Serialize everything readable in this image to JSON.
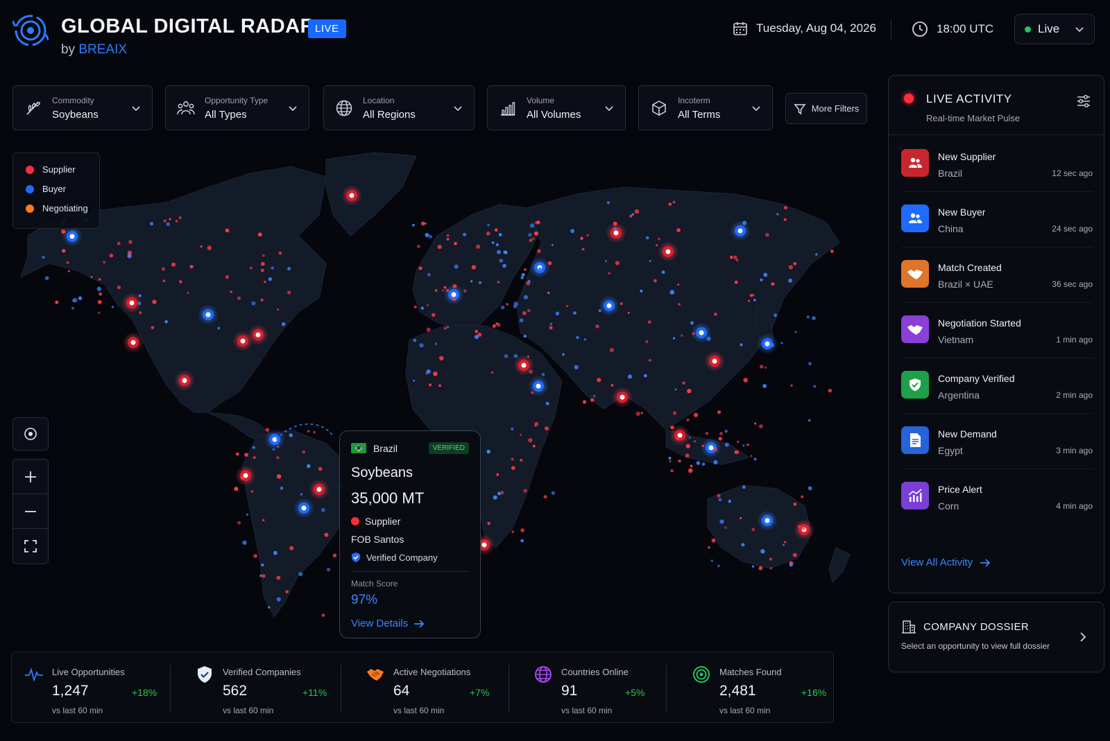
{
  "header": {
    "title": "GLOBAL DIGITAL RADAR",
    "live_badge": "LIVE",
    "by": "by",
    "brand": "BREAIX",
    "date": "Tuesday, Aug 04, 2026",
    "time": "18:00 UTC",
    "mode_select": "Live"
  },
  "filters": [
    {
      "label": "Commodity",
      "value": "Soybeans",
      "icon": "sprout-icon"
    },
    {
      "label": "Opportunity  Type",
      "value": "All Types",
      "icon": "people-icon"
    },
    {
      "label": "Location",
      "value": "All Regions",
      "icon": "globe-icon"
    },
    {
      "label": "Volume",
      "value": "All Volumes",
      "icon": "bar-chart-icon"
    },
    {
      "label": "Incoterm",
      "value": "All Terms",
      "icon": "box-icon"
    }
  ],
  "more_filters": "More Filters",
  "legend": [
    {
      "label": "Supplier",
      "color": "#ff2d3a"
    },
    {
      "label": "Buyer",
      "color": "#1f6bff"
    },
    {
      "label": "Negotiating",
      "color": "#ff7a1a"
    }
  ],
  "popup": {
    "country": "Brazil",
    "badge": "VERIFIED",
    "commodity": "Soybeans",
    "quantity": "35,000 MT",
    "role": "Supplier",
    "incoterm": "FOB Santos",
    "verified": "Verified Company",
    "match_label": "Match Score",
    "match_value": "97%",
    "view_details": "View Details"
  },
  "stats": [
    {
      "label": "Live Opportunities",
      "value": "1,247",
      "change": "+18%",
      "sub": "vs last 60 min",
      "icon": "pulse-icon"
    },
    {
      "label": "Verified Companies",
      "value": "562",
      "change": "+11%",
      "sub": "vs last 60 min",
      "icon": "shield-check-icon"
    },
    {
      "label": "Active Negotiations",
      "value": "64",
      "change": "+7%",
      "sub": "vs last 60 min",
      "icon": "handshake-icon"
    },
    {
      "label": "Countries Online",
      "value": "91",
      "change": "+5%",
      "sub": "vs last 60 min",
      "icon": "globe-icon"
    },
    {
      "label": "Matches Found",
      "value": "2,481",
      "change": "+16%",
      "sub": "vs last 60 min",
      "icon": "target-icon"
    }
  ],
  "activity": {
    "title": "LIVE ACTIVITY",
    "subtitle": "Real-time Market Pulse",
    "items": [
      {
        "title": "New Supplier",
        "location": "Brazil",
        "time": "12 sec ago",
        "color": "#c8262f",
        "icon": "users-icon"
      },
      {
        "title": "New Buyer",
        "location": "China",
        "time": "24 sec ago",
        "color": "#1f6bff",
        "icon": "users-icon"
      },
      {
        "title": "Match Created",
        "location": "Brazil × UAE",
        "time": "36 sec ago",
        "color": "#e0742a",
        "icon": "handshake-icon"
      },
      {
        "title": "Negotiation Started",
        "location": "Vietnam",
        "time": "1 min ago",
        "color": "#8a3fd6",
        "icon": "handshake-icon"
      },
      {
        "title": "Company Verified",
        "location": "Argentina",
        "time": "2 min ago",
        "color": "#1ea04a",
        "icon": "shield-check-icon"
      },
      {
        "title": "New Demand",
        "location": "Egypt",
        "time": "3 min ago",
        "color": "#2563d9",
        "icon": "document-icon"
      },
      {
        "title": "Price Alert",
        "location": "Corn",
        "time": "4 min ago",
        "color": "#7b3fd6",
        "icon": "chart-up-icon"
      }
    ],
    "view_all": "View All Activity"
  },
  "dossier": {
    "title": "COMPANY DOSSIER",
    "subtitle": "Select an opportunity to view full dossier"
  }
}
